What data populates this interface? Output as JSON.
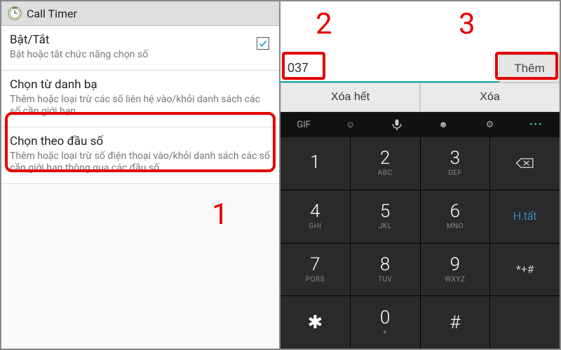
{
  "left": {
    "app_title": "Call Timer",
    "items": [
      {
        "title": "Bật/Tắt",
        "sub": "Bật hoặc tắt chức năng chọn số",
        "checked": true
      },
      {
        "title": "Chọn từ danh bạ",
        "sub": "Thêm hoặc loại trừ các số liên hệ vào/khỏi danh sách các số cần giới hạn"
      },
      {
        "title": "Chọn theo đầu số",
        "sub": "Thêm hoặc loại trừ số điện thoại vào/khỏi danh sách các số cần giới hạn thông qua các đầu số"
      }
    ]
  },
  "right": {
    "input_value": "037",
    "add_label": "Thêm",
    "clear_all_label": "Xóa hết",
    "clear_label": "Xóa"
  },
  "keyboard": {
    "keys": [
      {
        "main": "1",
        "sub": ""
      },
      {
        "main": "2",
        "sub": "ABC"
      },
      {
        "main": "3",
        "sub": "DEF"
      },
      {
        "main": "",
        "sub": "",
        "type": "backspace"
      },
      {
        "main": "4",
        "sub": "GHI"
      },
      {
        "main": "5",
        "sub": "JKL"
      },
      {
        "main": "6",
        "sub": "MNO"
      },
      {
        "main": "H.tất",
        "sub": "",
        "type": "done"
      },
      {
        "main": "7",
        "sub": "PQRS"
      },
      {
        "main": "8",
        "sub": "TUV"
      },
      {
        "main": "9",
        "sub": "WXYZ"
      },
      {
        "main": "*+#",
        "sub": ""
      },
      {
        "main": "✱",
        "sub": ""
      },
      {
        "main": "0",
        "sub": "+"
      },
      {
        "main": "#",
        "sub": ""
      },
      {
        "main": "",
        "sub": ""
      }
    ]
  },
  "annotations": {
    "a1": "1",
    "a2": "2",
    "a3": "3"
  }
}
